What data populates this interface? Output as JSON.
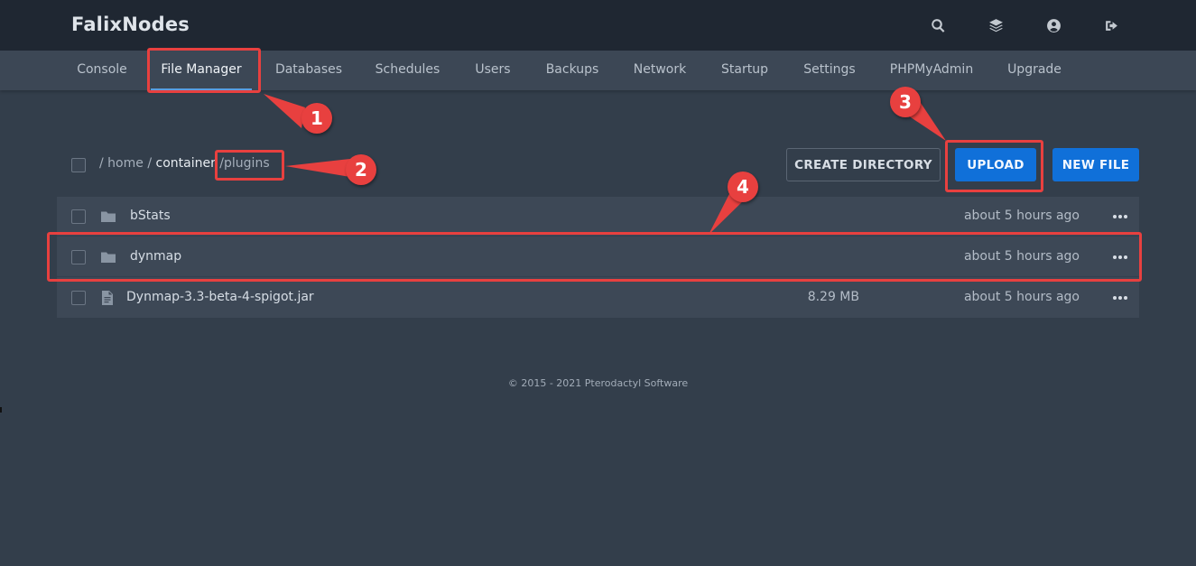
{
  "app": {
    "brand": "FalixNodes"
  },
  "topbar": {
    "icons": [
      "search-icon",
      "layers-icon",
      "account-icon",
      "logout-icon"
    ]
  },
  "nav": {
    "tabs": [
      {
        "label": "Console"
      },
      {
        "label": "File Manager",
        "active": true
      },
      {
        "label": "Databases"
      },
      {
        "label": "Schedules"
      },
      {
        "label": "Users"
      },
      {
        "label": "Backups"
      },
      {
        "label": "Network"
      },
      {
        "label": "Startup"
      },
      {
        "label": "Settings"
      },
      {
        "label": "PHPMyAdmin"
      },
      {
        "label": "Upgrade"
      }
    ]
  },
  "breadcrumb": {
    "sep": "/",
    "items": [
      "home",
      "container",
      "plugins"
    ]
  },
  "actions": {
    "create_directory": "CREATE DIRECTORY",
    "upload": "UPLOAD",
    "new_file": "NEW FILE"
  },
  "files": [
    {
      "name": "bStats",
      "type": "folder",
      "size": "",
      "modified": "about 5 hours ago"
    },
    {
      "name": "dynmap",
      "type": "folder",
      "size": "",
      "modified": "about 5 hours ago"
    },
    {
      "name": "Dynmap-3.3-beta-4-spigot.jar",
      "type": "file",
      "size": "8.29 MB",
      "modified": "about 5 hours ago"
    }
  ],
  "footer": {
    "text": "© 2015 - 2021 Pterodactyl Software"
  },
  "annotations": {
    "color": "#e8403f",
    "steps": [
      "1",
      "2",
      "3",
      "4"
    ]
  },
  "colors": {
    "accent": "#1070d9",
    "topbar": "#1f2732",
    "background": "#333e4b"
  }
}
